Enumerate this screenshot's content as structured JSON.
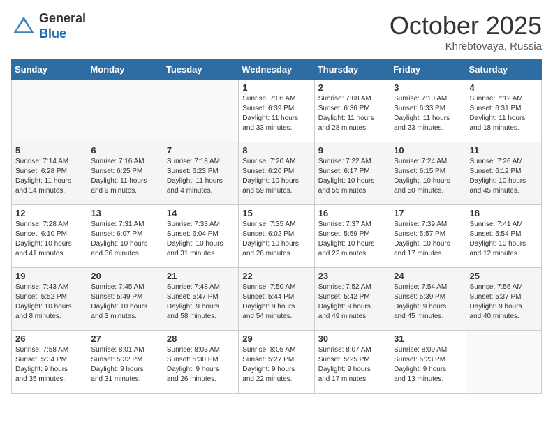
{
  "header": {
    "logo_line1": "General",
    "logo_line2": "Blue",
    "month": "October 2025",
    "location": "Khrebtovaya, Russia"
  },
  "weekdays": [
    "Sunday",
    "Monday",
    "Tuesday",
    "Wednesday",
    "Thursday",
    "Friday",
    "Saturday"
  ],
  "weeks": [
    [
      {
        "day": "",
        "info": ""
      },
      {
        "day": "",
        "info": ""
      },
      {
        "day": "",
        "info": ""
      },
      {
        "day": "1",
        "info": "Sunrise: 7:06 AM\nSunset: 6:39 PM\nDaylight: 11 hours\nand 33 minutes."
      },
      {
        "day": "2",
        "info": "Sunrise: 7:08 AM\nSunset: 6:36 PM\nDaylight: 11 hours\nand 28 minutes."
      },
      {
        "day": "3",
        "info": "Sunrise: 7:10 AM\nSunset: 6:33 PM\nDaylight: 11 hours\nand 23 minutes."
      },
      {
        "day": "4",
        "info": "Sunrise: 7:12 AM\nSunset: 6:31 PM\nDaylight: 11 hours\nand 18 minutes."
      }
    ],
    [
      {
        "day": "5",
        "info": "Sunrise: 7:14 AM\nSunset: 6:28 PM\nDaylight: 11 hours\nand 14 minutes."
      },
      {
        "day": "6",
        "info": "Sunrise: 7:16 AM\nSunset: 6:25 PM\nDaylight: 11 hours\nand 9 minutes."
      },
      {
        "day": "7",
        "info": "Sunrise: 7:18 AM\nSunset: 6:23 PM\nDaylight: 11 hours\nand 4 minutes."
      },
      {
        "day": "8",
        "info": "Sunrise: 7:20 AM\nSunset: 6:20 PM\nDaylight: 10 hours\nand 59 minutes."
      },
      {
        "day": "9",
        "info": "Sunrise: 7:22 AM\nSunset: 6:17 PM\nDaylight: 10 hours\nand 55 minutes."
      },
      {
        "day": "10",
        "info": "Sunrise: 7:24 AM\nSunset: 6:15 PM\nDaylight: 10 hours\nand 50 minutes."
      },
      {
        "day": "11",
        "info": "Sunrise: 7:26 AM\nSunset: 6:12 PM\nDaylight: 10 hours\nand 45 minutes."
      }
    ],
    [
      {
        "day": "12",
        "info": "Sunrise: 7:28 AM\nSunset: 6:10 PM\nDaylight: 10 hours\nand 41 minutes."
      },
      {
        "day": "13",
        "info": "Sunrise: 7:31 AM\nSunset: 6:07 PM\nDaylight: 10 hours\nand 36 minutes."
      },
      {
        "day": "14",
        "info": "Sunrise: 7:33 AM\nSunset: 6:04 PM\nDaylight: 10 hours\nand 31 minutes."
      },
      {
        "day": "15",
        "info": "Sunrise: 7:35 AM\nSunset: 6:02 PM\nDaylight: 10 hours\nand 26 minutes."
      },
      {
        "day": "16",
        "info": "Sunrise: 7:37 AM\nSunset: 5:59 PM\nDaylight: 10 hours\nand 22 minutes."
      },
      {
        "day": "17",
        "info": "Sunrise: 7:39 AM\nSunset: 5:57 PM\nDaylight: 10 hours\nand 17 minutes."
      },
      {
        "day": "18",
        "info": "Sunrise: 7:41 AM\nSunset: 5:54 PM\nDaylight: 10 hours\nand 12 minutes."
      }
    ],
    [
      {
        "day": "19",
        "info": "Sunrise: 7:43 AM\nSunset: 5:52 PM\nDaylight: 10 hours\nand 8 minutes."
      },
      {
        "day": "20",
        "info": "Sunrise: 7:45 AM\nSunset: 5:49 PM\nDaylight: 10 hours\nand 3 minutes."
      },
      {
        "day": "21",
        "info": "Sunrise: 7:48 AM\nSunset: 5:47 PM\nDaylight: 9 hours\nand 58 minutes."
      },
      {
        "day": "22",
        "info": "Sunrise: 7:50 AM\nSunset: 5:44 PM\nDaylight: 9 hours\nand 54 minutes."
      },
      {
        "day": "23",
        "info": "Sunrise: 7:52 AM\nSunset: 5:42 PM\nDaylight: 9 hours\nand 49 minutes."
      },
      {
        "day": "24",
        "info": "Sunrise: 7:54 AM\nSunset: 5:39 PM\nDaylight: 9 hours\nand 45 minutes."
      },
      {
        "day": "25",
        "info": "Sunrise: 7:56 AM\nSunset: 5:37 PM\nDaylight: 9 hours\nand 40 minutes."
      }
    ],
    [
      {
        "day": "26",
        "info": "Sunrise: 7:58 AM\nSunset: 5:34 PM\nDaylight: 9 hours\nand 35 minutes."
      },
      {
        "day": "27",
        "info": "Sunrise: 8:01 AM\nSunset: 5:32 PM\nDaylight: 9 hours\nand 31 minutes."
      },
      {
        "day": "28",
        "info": "Sunrise: 8:03 AM\nSunset: 5:30 PM\nDaylight: 9 hours\nand 26 minutes."
      },
      {
        "day": "29",
        "info": "Sunrise: 8:05 AM\nSunset: 5:27 PM\nDaylight: 9 hours\nand 22 minutes."
      },
      {
        "day": "30",
        "info": "Sunrise: 8:07 AM\nSunset: 5:25 PM\nDaylight: 9 hours\nand 17 minutes."
      },
      {
        "day": "31",
        "info": "Sunrise: 8:09 AM\nSunset: 5:23 PM\nDaylight: 9 hours\nand 13 minutes."
      },
      {
        "day": "",
        "info": ""
      }
    ]
  ]
}
